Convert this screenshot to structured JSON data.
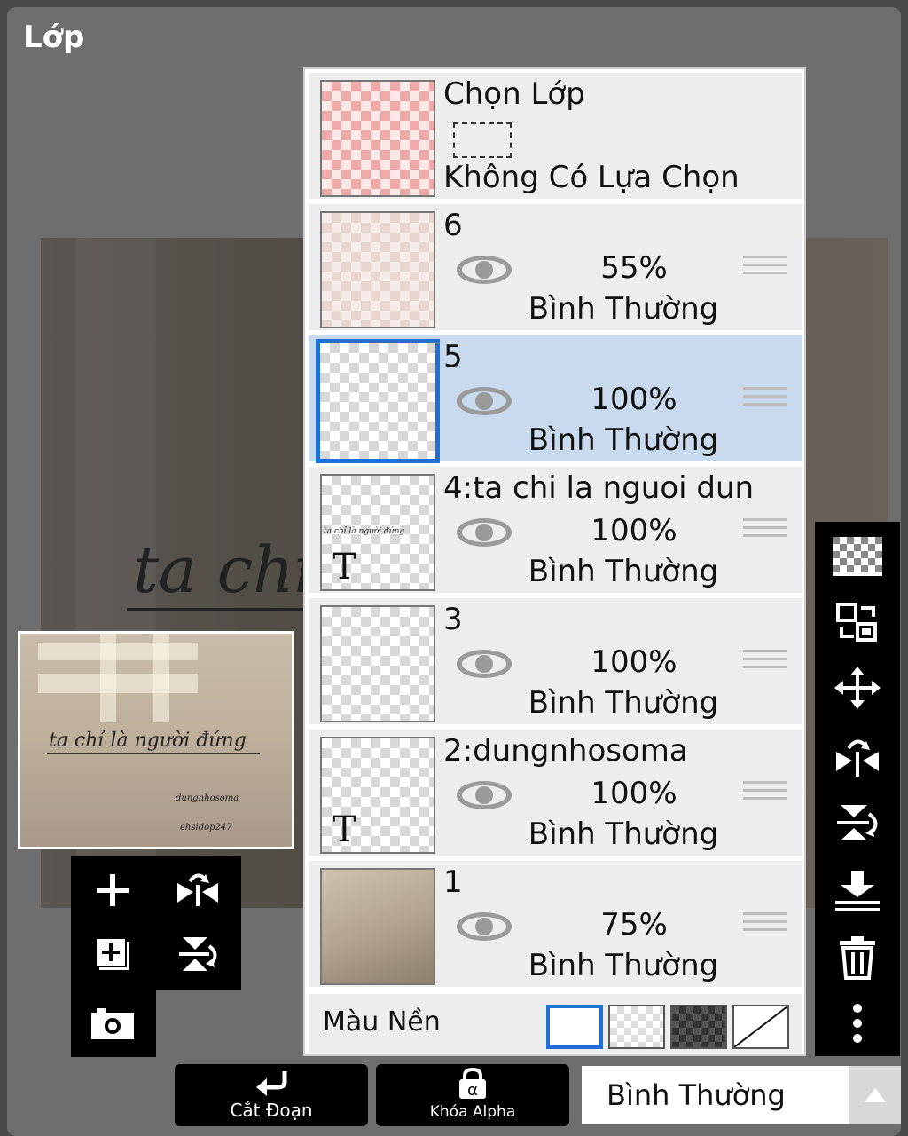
{
  "window": {
    "title": "Lớp"
  },
  "canvas": {
    "text": "ta chi"
  },
  "navigator": {
    "title": "ta chỉ là người đứng",
    "small1": "dungnhosoma",
    "small2": "ehsidop247"
  },
  "selection_layer": {
    "title": "Chọn Lớp",
    "status": "Không Có Lựa Chọn"
  },
  "layers": [
    {
      "name": "6",
      "opacity": "55%",
      "blend": "Bình Thường"
    },
    {
      "name": "5",
      "opacity": "100%",
      "blend": "Bình Thường",
      "selected": true
    },
    {
      "name": "4:ta chi la nguoi dun",
      "opacity": "100%",
      "blend": "Bình Thường",
      "thumb_text": "ta chỉ là người đứng",
      "type_glyph": "T"
    },
    {
      "name": "3",
      "opacity": "100%",
      "blend": "Bình Thường"
    },
    {
      "name": "2:dungnhosoma",
      "opacity": "100%",
      "blend": "Bình Thường",
      "type_glyph": "T"
    },
    {
      "name": "1",
      "opacity": "75%",
      "blend": "Bình Thường"
    }
  ],
  "background_color": {
    "label": "Màu Nền"
  },
  "bottom_bar": {
    "clip_label": "Cắt Đoạn",
    "alpha_lock_label": "Khóa Alpha",
    "blend_mode": "Bình Thường"
  },
  "colors": {
    "selected_layer": "#c9daee",
    "accent": "#1f6fd6",
    "toolbar": "#000000"
  },
  "icons": {
    "left_toolbar": [
      "plus-icon",
      "flip-horizontal-icon",
      "add-layer-icon",
      "flip-vertical-icon",
      "camera-icon"
    ],
    "right_toolbar": [
      "transparency-icon",
      "swap-layer-icon",
      "move-icon",
      "flip-horizontal-icon",
      "flip-vertical-icon",
      "merge-down-icon",
      "trash-icon",
      "more-icon"
    ]
  }
}
